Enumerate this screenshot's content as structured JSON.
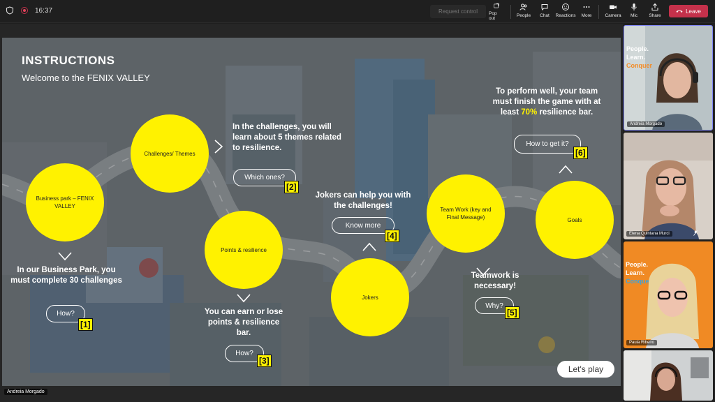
{
  "topbar": {
    "time": "16:37",
    "request_control": "Request control",
    "buttons": {
      "pop_out": "Pop out",
      "people": "People",
      "chat": "Chat",
      "reactions": "Reactions",
      "more": "More",
      "camera": "Camera",
      "mic": "Mic",
      "share": "Share"
    },
    "leave": "Leave",
    "leave_color": "#c4314b"
  },
  "slide": {
    "title": "INSTRUCTIONS",
    "subtitle": "Welcome to the FENIX VALLEY",
    "accent": "#fff200",
    "nodes": {
      "business_park": "Business park – FENIX VALLEY",
      "challenges": "Challenges/ Themes",
      "points": "Points & resilience",
      "jokers": "Jokers",
      "teamwork": "Team Work (key and Final Message)",
      "goals": "Goals"
    },
    "texts": {
      "business_park": "In our Business Park, you must complete 30 challenges",
      "challenges": "In the challenges, you will learn about 5 themes related to resilience.",
      "points": "You can earn or lose points & resilience bar.",
      "jokers": "Jokers can help you with the challenges!",
      "teamwork": "Teamwork is necessary!",
      "goals_1": "To perform well, your team must finish the game with at least ",
      "goals_pct": "70%",
      "goals_2": " resilience bar."
    },
    "pills": {
      "how_1": "How?",
      "which": "Which ones?",
      "how_3": "How?",
      "know_more": "Know more",
      "why": "Why?",
      "how_get": "How to get it?"
    },
    "numbers": [
      "[1]",
      "[2]",
      "[3]",
      "[4]",
      "[5]",
      "[6]"
    ],
    "lets_play": "Let's play"
  },
  "presenter_label": "Andreia Morgado",
  "participants": [
    {
      "name": "Andreia Morgado",
      "tile_text": "People. Learn. Conquer"
    },
    {
      "name": "Elena Quintana Murci"
    },
    {
      "name": "Paula Ribeiro",
      "tile_text": "People. Learn. Conquer"
    },
    {
      "name": ""
    }
  ]
}
